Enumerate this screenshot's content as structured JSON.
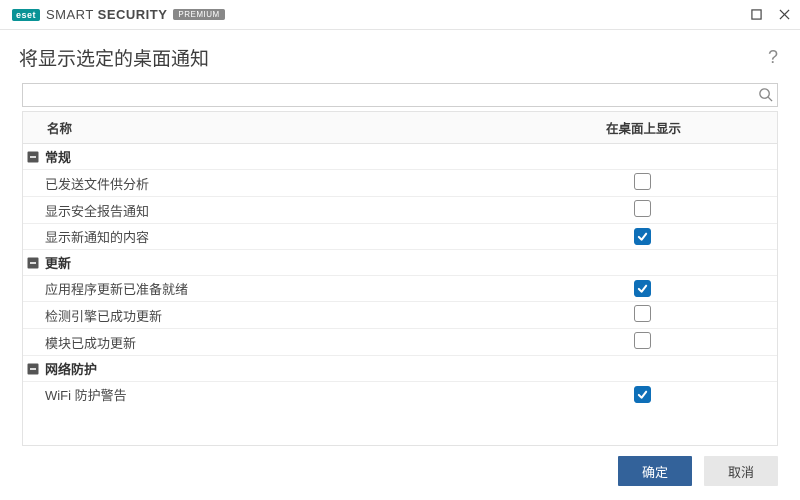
{
  "brand": {
    "logo": "eset",
    "main1": "SMART ",
    "main2": "SECURITY",
    "tier": "PREMIUM"
  },
  "page_title": "将显示选定的桌面通知",
  "columns": {
    "name": "名称",
    "show": "在桌面上显示"
  },
  "groups": [
    {
      "label": "常规",
      "items": [
        {
          "label": "已发送文件供分析",
          "checked": false
        },
        {
          "label": "显示安全报告通知",
          "checked": false
        },
        {
          "label": "显示新通知的内容",
          "checked": true
        }
      ]
    },
    {
      "label": "更新",
      "items": [
        {
          "label": "应用程序更新已准备就绪",
          "checked": true
        },
        {
          "label": "检测引擎已成功更新",
          "checked": false
        },
        {
          "label": "模块已成功更新",
          "checked": false
        }
      ]
    },
    {
      "label": "网络防护",
      "items": [
        {
          "label": "WiFi 防护警告",
          "checked": true
        }
      ]
    }
  ],
  "buttons": {
    "ok": "确定",
    "cancel": "取消"
  },
  "search": {
    "value": ""
  }
}
